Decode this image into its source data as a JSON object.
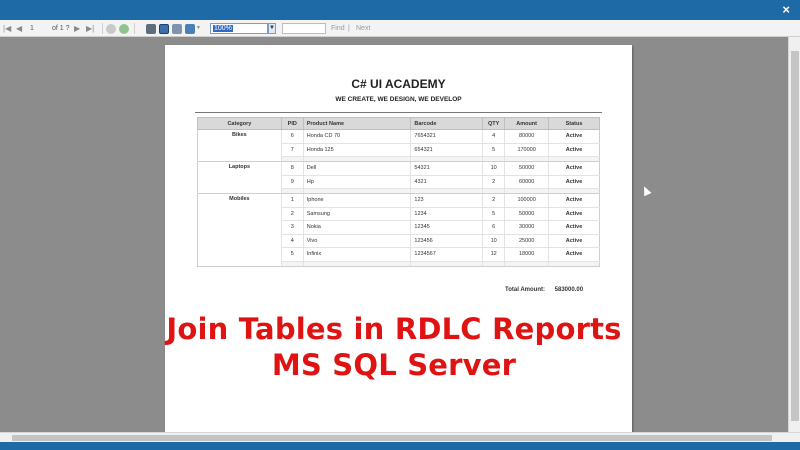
{
  "window": {
    "close_glyph": "×"
  },
  "toolbar": {
    "first_glyph": "|◀",
    "prev_glyph": "◀",
    "page_current": "1",
    "page_of": "of 1 ?",
    "next_glyph": "▶",
    "last_glyph": "▶|",
    "zoom_value": "100%",
    "zoom_arrow": "▼",
    "find_label": "Find",
    "find_sep": "|",
    "next_label": "Next",
    "icons": [
      "stop-icon",
      "refresh-icon",
      "print-icon",
      "print-layout-icon",
      "page-setup-icon",
      "export-icon"
    ]
  },
  "report": {
    "title": "C# UI ACADEMY",
    "subtitle": "WE CREATE, WE DESIGN, WE DEVELOP",
    "columns": [
      "Category",
      "PID",
      "Product Name",
      "Barcode",
      "QTY",
      "Amount",
      "Status"
    ],
    "groups": [
      {
        "category": "Bikes",
        "rows": [
          {
            "pid": "6",
            "name": "Honda CD 70",
            "barcode": "7654321",
            "qty": "4",
            "amount": "80000",
            "status": "Active"
          },
          {
            "pid": "7",
            "name": "Honda 125",
            "barcode": "654321",
            "qty": "5",
            "amount": "170000",
            "status": "Active"
          }
        ]
      },
      {
        "category": "Laptops",
        "rows": [
          {
            "pid": "8",
            "name": "Dell",
            "barcode": "54321",
            "qty": "10",
            "amount": "50000",
            "status": "Active"
          },
          {
            "pid": "9",
            "name": "Hp",
            "barcode": "4321",
            "qty": "2",
            "amount": "60000",
            "status": "Active"
          }
        ]
      },
      {
        "category": "Mobiles",
        "rows": [
          {
            "pid": "1",
            "name": "Iphone",
            "barcode": "123",
            "qty": "2",
            "amount": "100000",
            "status": "Active"
          },
          {
            "pid": "2",
            "name": "Samsung",
            "barcode": "1234",
            "qty": "5",
            "amount": "50000",
            "status": "Active"
          },
          {
            "pid": "3",
            "name": "Nokia",
            "barcode": "12345",
            "qty": "6",
            "amount": "30000",
            "status": "Active"
          },
          {
            "pid": "4",
            "name": "Vivo",
            "barcode": "123456",
            "qty": "10",
            "amount": "25000",
            "status": "Active"
          },
          {
            "pid": "5",
            "name": "Infinix",
            "barcode": "1234567",
            "qty": "12",
            "amount": "18000",
            "status": "Active"
          }
        ]
      }
    ],
    "total_label": "Total Amount:",
    "total_value": "583000.00"
  },
  "overlay": {
    "line1": "Join Tables in RDLC Reports",
    "line2": "MS SQL Server"
  },
  "colors": {
    "titlebar": "#1e6aa6",
    "viewer_bg": "#8c8c8c",
    "overlay_red": "#e01313"
  }
}
